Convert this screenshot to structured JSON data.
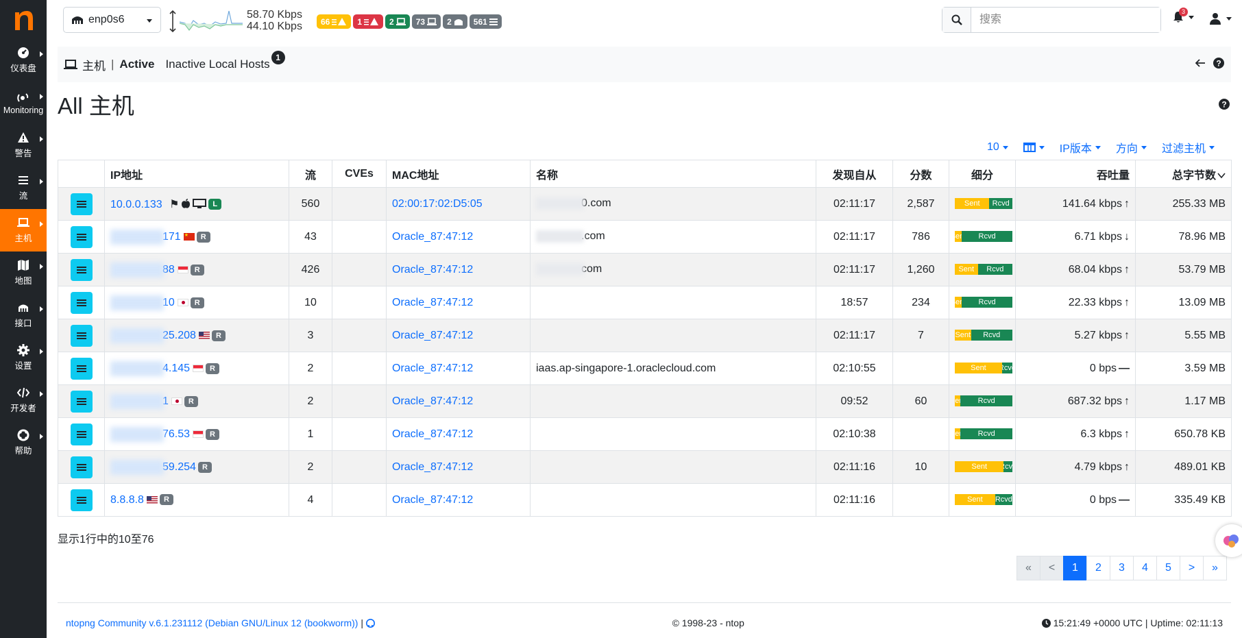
{
  "sidebar": {
    "items": [
      {
        "label": "仪表盘",
        "icon": "gauge-icon"
      },
      {
        "label": "Monitoring",
        "icon": "satellite-icon"
      },
      {
        "label": "警告",
        "icon": "warning-icon"
      },
      {
        "label": "流",
        "icon": "list-icon"
      },
      {
        "label": "主机",
        "icon": "laptop-icon",
        "active": true
      },
      {
        "label": "地图",
        "icon": "map-icon"
      },
      {
        "label": "接口",
        "icon": "ethernet-icon"
      },
      {
        "label": "设置",
        "icon": "gear-icon"
      },
      {
        "label": "开发者",
        "icon": "code-icon"
      },
      {
        "label": "帮助",
        "icon": "lifebuoy-icon"
      }
    ]
  },
  "topbar": {
    "interface": "enp0s6",
    "upload": "58.70 Kbps",
    "download": "44.10 Kbps",
    "badges": [
      {
        "value": "66",
        "color": "yellow",
        "icon": "list-warning-icon"
      },
      {
        "value": "1",
        "color": "red",
        "icon": "list-warning-icon"
      },
      {
        "value": "2",
        "color": "green",
        "icon": "laptop-icon"
      },
      {
        "value": "73",
        "color": "grey",
        "icon": "laptop-icon"
      },
      {
        "value": "2",
        "color": "grey",
        "icon": "ethernet-icon"
      },
      {
        "value": "561",
        "color": "grey",
        "icon": "list-icon"
      }
    ],
    "search_placeholder": "搜索",
    "notifications": "3"
  },
  "subnav": {
    "section": "主机",
    "active_tab": "Active",
    "inactive_tab": "Inactive Local Hosts",
    "inactive_count": "1"
  },
  "page_title": "All 主机",
  "toolbar": {
    "page_size": "10",
    "ip_version": "IP版本",
    "direction": "方向",
    "filter": "过滤主机"
  },
  "table": {
    "headers": [
      "",
      "IP地址",
      "流",
      "CVEs",
      "MAC地址",
      "名称",
      "发现自从",
      "分数",
      "细分",
      "吞吐量",
      "总字节数"
    ],
    "rows": [
      {
        "ip": "10.0.0.133",
        "ip_blur": false,
        "flag": "",
        "badge": "L",
        "flows": "560",
        "cves": "",
        "mac": "02:00:17:02:D5:05",
        "name_blur": true,
        "name": "0.com",
        "seen": "02:11:17",
        "score": "2,587",
        "sent_pct": 60,
        "throughput": "141.64 kbps",
        "trend": "↑",
        "bytes": "255.33 MB"
      },
      {
        "ip": "171",
        "ip_blur": true,
        "flag": "cn",
        "badge": "R",
        "flows": "43",
        "cves": "",
        "mac": "Oracle_87:47:12",
        "name_blur": true,
        "name": ".com",
        "seen": "02:11:17",
        "score": "786",
        "sent_pct": 12,
        "throughput": "6.71 kbps",
        "trend": "↓",
        "bytes": "78.96 MB"
      },
      {
        "ip": "88",
        "ip_blur": true,
        "flag": "sg",
        "badge": "R",
        "flows": "426",
        "cves": "",
        "mac": "Oracle_87:47:12",
        "name_blur": true,
        "name": "com",
        "seen": "02:11:17",
        "score": "1,260",
        "sent_pct": 40,
        "throughput": "68.04 kbps",
        "trend": "↑",
        "bytes": "53.79 MB"
      },
      {
        "ip": "10",
        "ip_blur": true,
        "flag": "jp",
        "badge": "R",
        "flows": "10",
        "cves": "",
        "mac": "Oracle_87:47:12",
        "name_blur": false,
        "name": "",
        "seen": "18:57",
        "score": "234",
        "sent_pct": 12,
        "throughput": "22.33 kbps",
        "trend": "↑",
        "bytes": "13.09 MB"
      },
      {
        "ip": "25.208",
        "ip_blur": true,
        "flag": "us",
        "badge": "R",
        "flows": "3",
        "cves": "",
        "mac": "Oracle_87:47:12",
        "name_blur": false,
        "name": "",
        "seen": "02:11:17",
        "score": "7",
        "sent_pct": 28,
        "throughput": "5.27 kbps",
        "trend": "↑",
        "bytes": "5.55 MB"
      },
      {
        "ip": "4.145",
        "ip_blur": true,
        "flag": "sg",
        "badge": "R",
        "flows": "2",
        "cves": "",
        "mac": "Oracle_87:47:12",
        "name_blur": false,
        "name": "iaas.ap-singapore-1.oraclecloud.com",
        "seen": "02:10:55",
        "score": "",
        "sent_pct": 82,
        "throughput": "0 bps",
        "trend": "—",
        "bytes": "3.59 MB"
      },
      {
        "ip": "1",
        "ip_blur": true,
        "flag": "jp",
        "badge": "R",
        "flows": "2",
        "cves": "",
        "mac": "Oracle_87:47:12",
        "name_blur": false,
        "name": "",
        "seen": "09:52",
        "score": "60",
        "sent_pct": 10,
        "throughput": "687.32 bps",
        "trend": "↑",
        "bytes": "1.17 MB"
      },
      {
        "ip": "76.53",
        "ip_blur": true,
        "flag": "sg",
        "badge": "R",
        "flows": "1",
        "cves": "",
        "mac": "Oracle_87:47:12",
        "name_blur": false,
        "name": "",
        "seen": "02:10:38",
        "score": "",
        "sent_pct": 10,
        "throughput": "6.3 kbps",
        "trend": "↑",
        "bytes": "650.78 KB"
      },
      {
        "ip": "59.254",
        "ip_blur": true,
        "flag": "",
        "badge": "R",
        "flows": "2",
        "cves": "",
        "mac": "Oracle_87:47:12",
        "name_blur": false,
        "name": "",
        "seen": "02:11:16",
        "score": "10",
        "sent_pct": 85,
        "throughput": "4.79 kbps",
        "trend": "↑",
        "bytes": "489.01 KB"
      },
      {
        "ip": "8.8.8.8",
        "ip_blur": false,
        "flag": "us",
        "badge": "R",
        "flows": "4",
        "cves": "",
        "mac": "Oracle_87:47:12",
        "name_blur": false,
        "name": "",
        "seen": "02:11:16",
        "score": "",
        "sent_pct": 70,
        "throughput": "0 bps",
        "trend": "—",
        "bytes": "335.49 KB"
      }
    ],
    "sent_label": "Sent",
    "rcvd_label": "Rcvd"
  },
  "info_text": "显示1行中的10至76",
  "pagination": [
    "«",
    "<",
    "1",
    "2",
    "3",
    "4",
    "5",
    ">",
    "»"
  ],
  "pagination_current": "1",
  "footer": {
    "version": "ntopng Community v.6.1.231112 (Debian GNU/Linux 12 (bookworm))",
    "copyright": "© 1998-23 - ntop",
    "clock": "15:21:49 +0000 UTC | Uptime: 02:11:13"
  },
  "colors": {
    "accent": "#ff7500",
    "link": "#0d6efd",
    "sidebar": "#212529",
    "action": "#0dcaf0"
  }
}
